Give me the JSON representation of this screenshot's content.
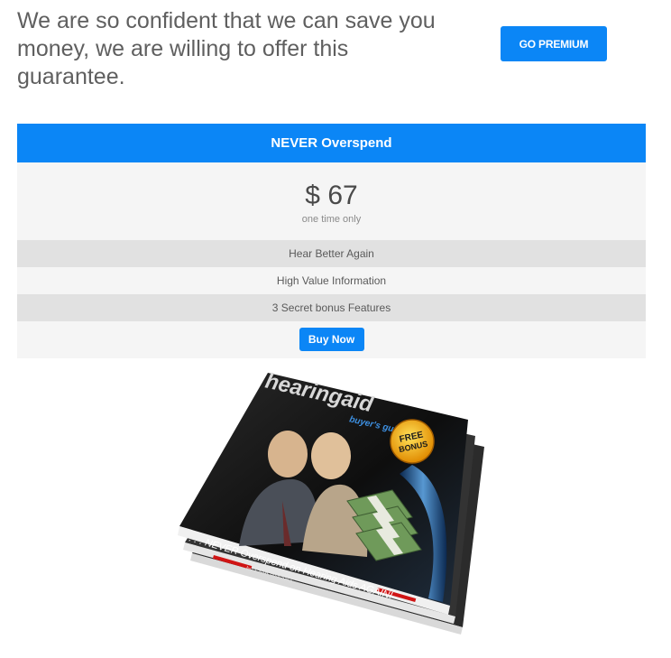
{
  "headline": "We are so confident that we can save you money, we are willing to offer this guarantee.",
  "go_premium_label": "GO PREMIUM",
  "plan": {
    "title": "NEVER Overspend",
    "price": "$ 67",
    "price_note": "one time only",
    "features": [
      "Hear Better Again",
      "High Value Information",
      "3 Secret bonus Features"
    ],
    "buy_label": "Buy Now"
  },
  "book": {
    "brand_main": "hearingaid",
    "brand_sub": "buyer's guide",
    "badge": [
      "FREE",
      "BONUS"
    ],
    "tagline": ". . . NEVER Overspend on Hearing Aids AGAIN!",
    "author": "by Scott Williams"
  },
  "colors": {
    "accent": "#0b86f6",
    "headline_text": "#5f5f5f",
    "row_dark": "#e1e1e1",
    "row_light": "#f5f5f5"
  }
}
